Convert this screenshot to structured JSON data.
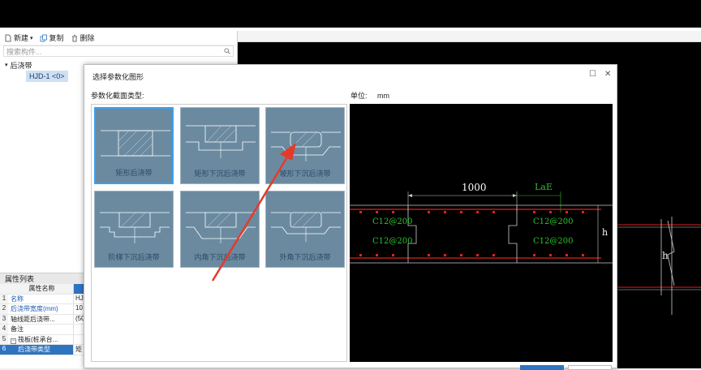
{
  "toolbar": {
    "new_label": "新建",
    "copy_label": "复制",
    "delete_label": "删除"
  },
  "search": {
    "placeholder": "搜索构件..."
  },
  "tree": {
    "parent_label": "后浇带",
    "child_label": "HJD-1 <0>"
  },
  "properties": {
    "title": "属性列表",
    "header_name": "属性名称",
    "rows": [
      {
        "num": "1",
        "name": "名称",
        "value": "HJ"
      },
      {
        "num": "2",
        "name": "后浇带宽度(mm)",
        "value": "10"
      },
      {
        "num": "3",
        "name": "轴线距后浇带...",
        "value": "(50"
      },
      {
        "num": "4",
        "name": "备注",
        "value": ""
      },
      {
        "num": "5",
        "name": "筏板(桩承台...",
        "value": ""
      },
      {
        "num": "6",
        "name": "后浇带类型",
        "value": "矩"
      }
    ]
  },
  "dialog": {
    "title": "选择参数化图形",
    "type_label": "参数化截面类型:",
    "unit_label": "单位:",
    "unit_value": "mm",
    "thumbnails": [
      "矩形后浇带",
      "矩形下沉后浇带",
      "坡形下沉后浇带",
      "阶梯下沉后浇带",
      "内角下沉后浇带",
      "外角下沉后浇带"
    ]
  },
  "preview": {
    "dim_width": "1000",
    "dim_lae": "LaE",
    "rebar_labels": [
      "C12@200",
      "C12@200",
      "C12@200",
      "C12@200"
    ],
    "h_label": "h"
  },
  "colors": {
    "accent": "#2f74c0",
    "rebar_red": "#e02020",
    "dim_green": "#2ec02e",
    "arrow_red": "#e53a2a"
  }
}
